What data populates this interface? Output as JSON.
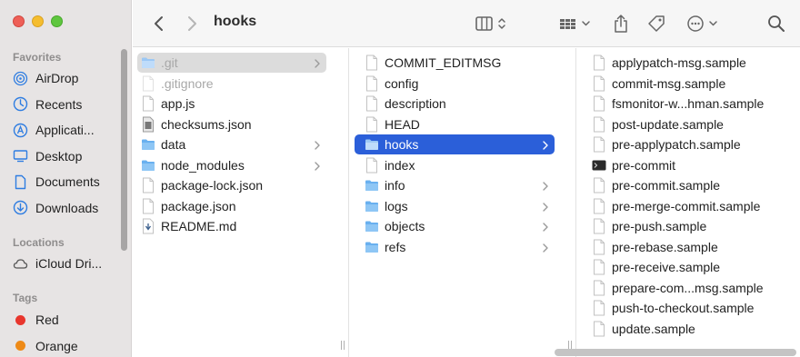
{
  "window": {
    "title": "hooks"
  },
  "sidebar": {
    "favorites_label": "Favorites",
    "favorites": [
      {
        "label": "AirDrop",
        "icon": "airdrop-icon"
      },
      {
        "label": "Recents",
        "icon": "clock-icon"
      },
      {
        "label": "Applicati...",
        "icon": "applications-icon"
      },
      {
        "label": "Desktop",
        "icon": "desktop-icon"
      },
      {
        "label": "Documents",
        "icon": "document-icon"
      },
      {
        "label": "Downloads",
        "icon": "download-icon"
      }
    ],
    "locations_label": "Locations",
    "locations": [
      {
        "label": "iCloud Dri...",
        "icon": "cloud-icon"
      }
    ],
    "tags_label": "Tags",
    "tags": [
      {
        "label": "Red",
        "color": "#e8362d"
      },
      {
        "label": "Orange",
        "color": "#ee8a17"
      }
    ]
  },
  "toolbar": {
    "back": "chevron-left-icon",
    "forward": "chevron-right-icon",
    "view": "columns-view-icon",
    "group": "group-icon",
    "share": "share-icon",
    "tags": "tag-icon",
    "more": "ellipsis-icon",
    "search": "search-icon"
  },
  "columns": {
    "col1": [
      {
        "name": ".git",
        "kind": "folder",
        "chevron": true,
        "selected": "gray",
        "hidden": true
      },
      {
        "name": ".gitignore",
        "kind": "file",
        "hidden": true
      },
      {
        "name": "app.js",
        "kind": "file"
      },
      {
        "name": "checksums.json",
        "kind": "file-dark"
      },
      {
        "name": "data",
        "kind": "folder",
        "chevron": true
      },
      {
        "name": "node_modules",
        "kind": "folder",
        "chevron": true
      },
      {
        "name": "package-lock.json",
        "kind": "file"
      },
      {
        "name": "package.json",
        "kind": "file"
      },
      {
        "name": "README.md",
        "kind": "file-md"
      }
    ],
    "col2": [
      {
        "name": "COMMIT_EDITMSG",
        "kind": "file"
      },
      {
        "name": "config",
        "kind": "file"
      },
      {
        "name": "description",
        "kind": "file"
      },
      {
        "name": "HEAD",
        "kind": "file"
      },
      {
        "name": "hooks",
        "kind": "folder",
        "chevron": true,
        "selected": "blue"
      },
      {
        "name": "index",
        "kind": "file"
      },
      {
        "name": "info",
        "kind": "folder",
        "chevron": true
      },
      {
        "name": "logs",
        "kind": "folder",
        "chevron": true
      },
      {
        "name": "objects",
        "kind": "folder",
        "chevron": true
      },
      {
        "name": "refs",
        "kind": "folder",
        "chevron": true
      }
    ],
    "col3": [
      {
        "name": "applypatch-msg.sample",
        "kind": "file"
      },
      {
        "name": "commit-msg.sample",
        "kind": "file"
      },
      {
        "name": "fsmonitor-w...hman.sample",
        "kind": "file"
      },
      {
        "name": "post-update.sample",
        "kind": "file"
      },
      {
        "name": "pre-applypatch.sample",
        "kind": "file"
      },
      {
        "name": "pre-commit",
        "kind": "exec"
      },
      {
        "name": "pre-commit.sample",
        "kind": "file"
      },
      {
        "name": "pre-merge-commit.sample",
        "kind": "file"
      },
      {
        "name": "pre-push.sample",
        "kind": "file"
      },
      {
        "name": "pre-rebase.sample",
        "kind": "file"
      },
      {
        "name": "pre-receive.sample",
        "kind": "file"
      },
      {
        "name": "prepare-com...msg.sample",
        "kind": "file"
      },
      {
        "name": "push-to-checkout.sample",
        "kind": "file"
      },
      {
        "name": "update.sample",
        "kind": "file"
      }
    ]
  }
}
